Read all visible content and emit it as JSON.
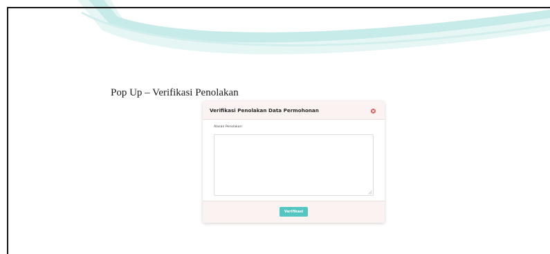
{
  "section_caption": "Pop Up – Verifikasi Penolakan",
  "modal": {
    "title": "Verifikasi Penolakan Data Permohonan",
    "close_icon": "close-circle-icon",
    "field_label": "Alasan Penolakan:",
    "textarea_value": "",
    "submit_label": "Verifikasi"
  },
  "colors": {
    "accent": "#53c6c2",
    "close": "#e2504a",
    "modal_bg": "#fbf3f2",
    "watermark": "#d4efed"
  }
}
